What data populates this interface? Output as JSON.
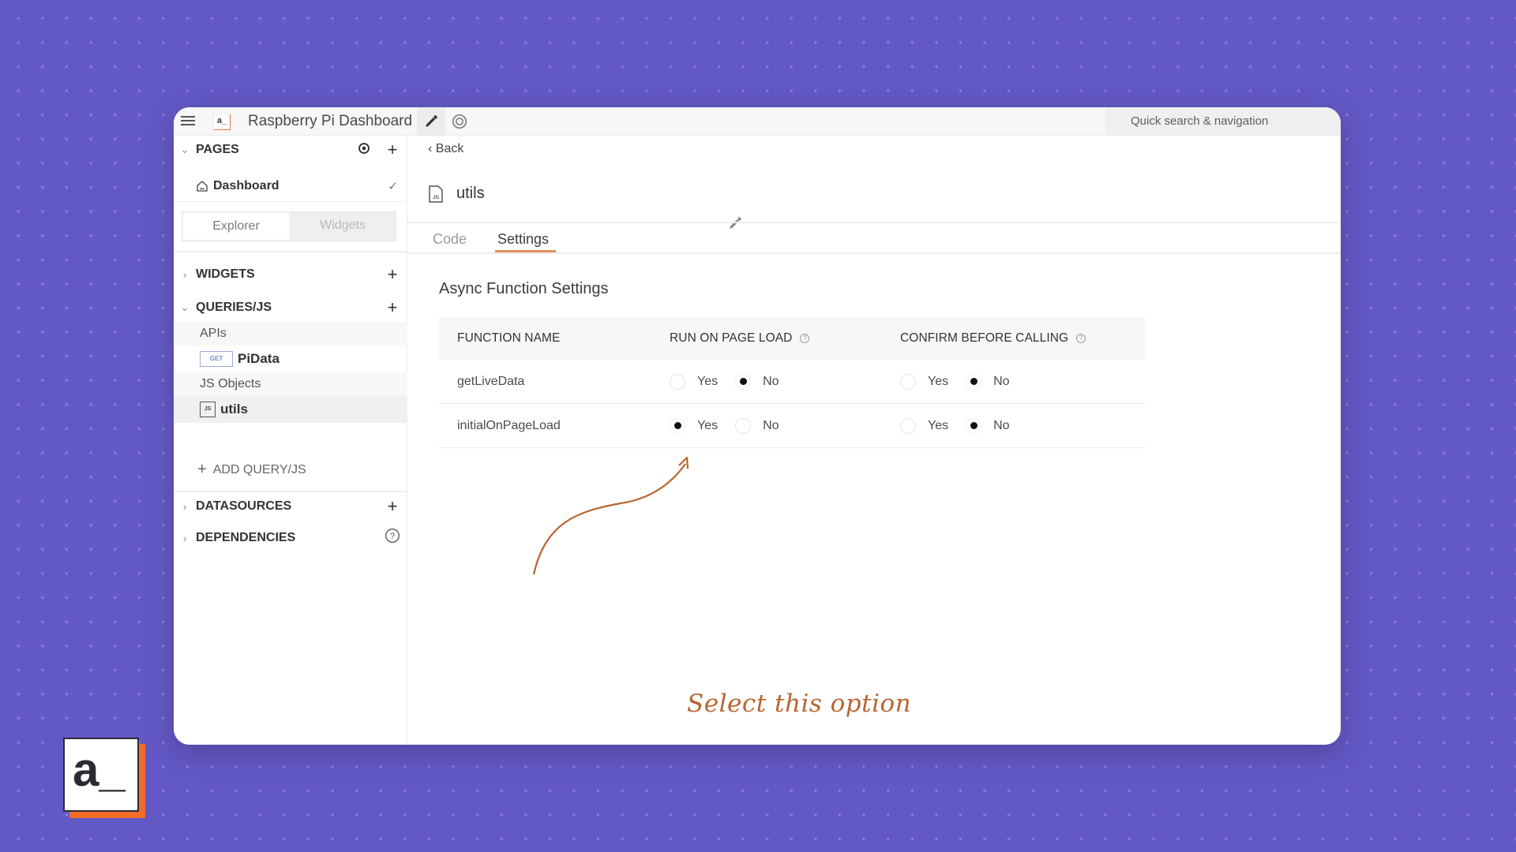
{
  "titlebar": {
    "app_name": "Raspberry Pi Dashboard",
    "logo_text": "a_",
    "search_placeholder": "Quick search & navigation"
  },
  "sidebar": {
    "pages_label": "PAGES",
    "current_page": "Dashboard",
    "switcher": {
      "explorer": "Explorer",
      "widgets": "Widgets"
    },
    "widgets_label": "WIDGETS",
    "queries_label": "QUERIES/JS",
    "apis_label": "APIs",
    "api_items": [
      {
        "method": "GET",
        "name": "PiData"
      }
    ],
    "js_objects_label": "JS Objects",
    "js_items": [
      {
        "badge": "JS",
        "name": "utils"
      }
    ],
    "add_query_label": "ADD QUERY/JS",
    "datasources_label": "DATASOURCES",
    "dependencies_label": "DEPENDENCIES"
  },
  "main": {
    "back_label": "Back",
    "file_badge": "JS",
    "file_name": "utils",
    "tabs": [
      {
        "label": "Code",
        "active": false
      },
      {
        "label": "Settings",
        "active": true
      }
    ],
    "section_title": "Async Function Settings",
    "table": {
      "headers": [
        "FUNCTION NAME",
        "RUN ON PAGE LOAD",
        "CONFIRM BEFORE CALLING"
      ],
      "option_yes": "Yes",
      "option_no": "No",
      "rows": [
        {
          "name": "getLiveData",
          "run_on_page_load": "No",
          "confirm_before_calling": "No"
        },
        {
          "name": "initialOnPageLoad",
          "run_on_page_load": "Yes",
          "confirm_before_calling": "No"
        }
      ]
    },
    "annotation": "Select this option",
    "annotation_color": "#b8642f"
  },
  "brand": {
    "logo_text": "a_",
    "accent": "#f26b29"
  },
  "colors": {
    "background": "#6359c6",
    "tab_underline": "#e58d5b"
  }
}
